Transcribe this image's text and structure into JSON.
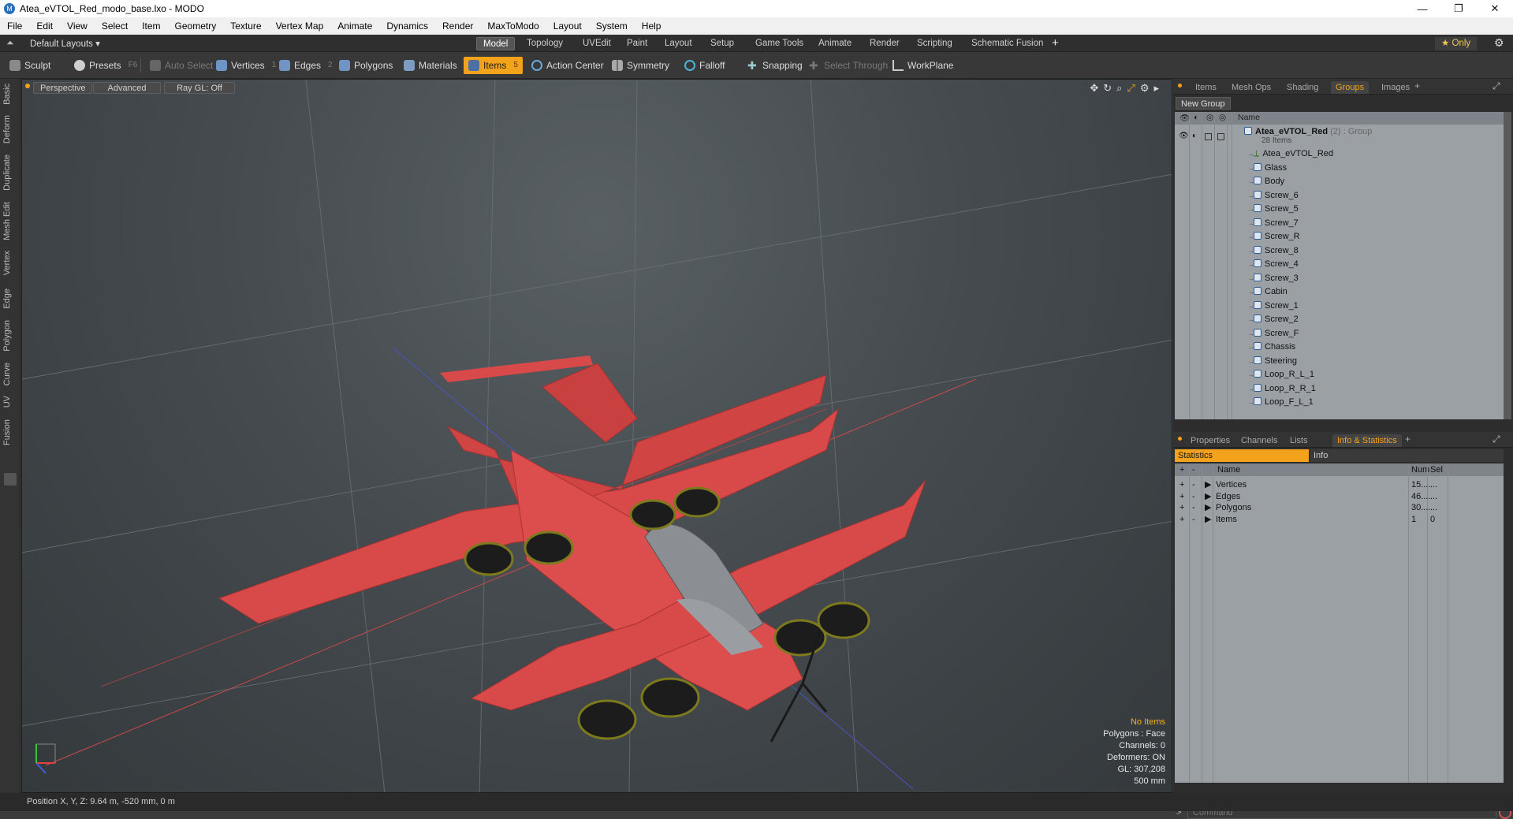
{
  "window": {
    "title": "Atea_eVTOL_Red_modo_base.lxo - MODO",
    "app_icon": "M"
  },
  "menu": [
    "File",
    "Edit",
    "View",
    "Select",
    "Item",
    "Geometry",
    "Texture",
    "Vertex Map",
    "Animate",
    "Dynamics",
    "Render",
    "MaxToModo",
    "Layout",
    "System",
    "Help"
  ],
  "layout": {
    "layouts_label": "Default Layouts ▾",
    "tabs": [
      "Model",
      "Topology",
      "UVEdit",
      "Paint",
      "Layout",
      "Setup",
      "Game Tools",
      "Animate",
      "Render",
      "Scripting",
      "Schematic Fusion"
    ],
    "active_tab": "Model",
    "only_label": "★ Only"
  },
  "toolbar": {
    "sculpt": "Sculpt",
    "presets": "Presets",
    "presets_key": "F6",
    "auto_select": "Auto Select",
    "vertices": "Vertices",
    "vertices_key": "1",
    "edges": "Edges",
    "edges_key": "2",
    "polygons": "Polygons",
    "materials": "Materials",
    "items": "Items",
    "items_key": "5",
    "action_center": "Action Center",
    "symmetry": "Symmetry",
    "falloff": "Falloff",
    "snapping": "Snapping",
    "select_through": "Select Through",
    "workplane": "WorkPlane"
  },
  "left_tabs": [
    "Basic",
    "Deform",
    "Duplicate",
    "Mesh Edit",
    "Vertex",
    "Edge",
    "Polygon",
    "Curve",
    "UV",
    "Fusion"
  ],
  "viewport": {
    "perspective": "Perspective",
    "advanced": "Advanced",
    "raygl": "Ray GL: Off",
    "hud": {
      "selection": "No Items",
      "polygons": "Polygons : Face",
      "channels": "Channels: 0",
      "deformers": "Deformers: ON",
      "gl": "GL: 307,208",
      "scale": "500 mm"
    }
  },
  "status": {
    "position": "Position X, Y, Z:   9.64 m, -520 mm, 0 m"
  },
  "items_panel": {
    "tabs": [
      "Items",
      "Mesh Ops",
      "Shading",
      "Groups",
      "Images"
    ],
    "active_tab": "Groups",
    "new_group": "New Group",
    "name_header": "Name",
    "group": {
      "name": "Atea_eVTOL_Red",
      "count": "(2)",
      "kind": ": Group",
      "sub": "28 Items"
    },
    "items": [
      "Atea_eVTOL_Red",
      "Glass",
      "Body",
      "Screw_6",
      "Screw_5",
      "Screw_7",
      "Screw_R",
      "Screw_8",
      "Screw_4",
      "Screw_3",
      "Cabin",
      "Screw_1",
      "Screw_2",
      "Screw_F",
      "Chassis",
      "Steering",
      "Loop_R_L_1",
      "Loop_R_R_1",
      "Loop_F_L_1"
    ]
  },
  "props_panel": {
    "tabs": [
      "Properties",
      "Channels",
      "Lists",
      "Info & Statistics"
    ],
    "active_tab": "Info & Statistics",
    "sub_tabs": [
      "Statistics",
      "Info"
    ],
    "headers": {
      "name": "Name",
      "num": "Num",
      "sel": "Sel"
    },
    "rows": [
      {
        "name": "Vertices",
        "num": "15....",
        "sel": "..."
      },
      {
        "name": "Edges",
        "num": "46....",
        "sel": "..."
      },
      {
        "name": "Polygons",
        "num": "30....",
        "sel": "..."
      },
      {
        "name": "Items",
        "num": "1",
        "sel": "0"
      }
    ]
  },
  "command": {
    "placeholder": "Command"
  },
  "colors": {
    "accent": "#f2a31b",
    "plane_red": "#d94848",
    "panel_bg": "#9aa0a4"
  }
}
